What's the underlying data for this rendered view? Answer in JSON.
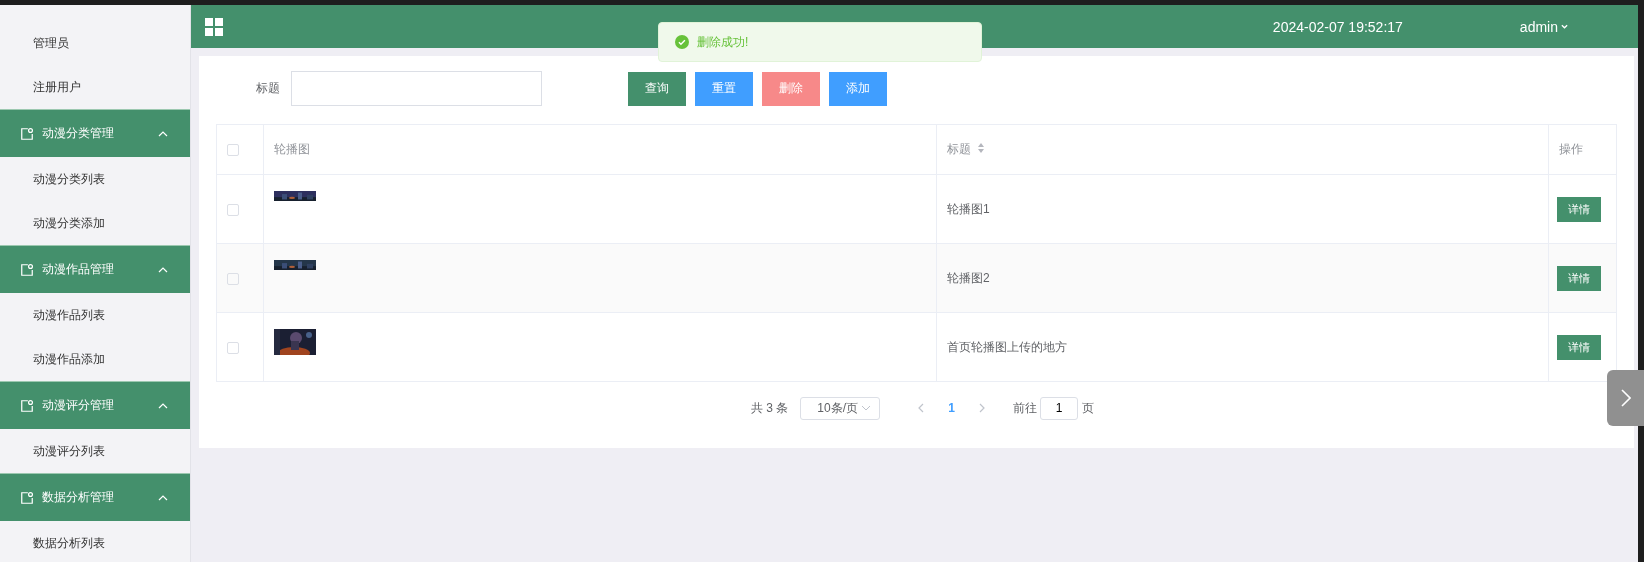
{
  "sidebar": {
    "items": [
      {
        "kind": "item",
        "label": "管理员"
      },
      {
        "kind": "item",
        "label": "注册用户"
      },
      {
        "kind": "group",
        "label": "动漫分类管理",
        "expanded": true,
        "children": [
          {
            "label": "动漫分类列表"
          },
          {
            "label": "动漫分类添加"
          }
        ]
      },
      {
        "kind": "group",
        "label": "动漫作品管理",
        "expanded": true,
        "children": [
          {
            "label": "动漫作品列表"
          },
          {
            "label": "动漫作品添加"
          }
        ]
      },
      {
        "kind": "group",
        "label": "动漫评分管理",
        "expanded": true,
        "children": [
          {
            "label": "动漫评分列表"
          }
        ]
      },
      {
        "kind": "group",
        "label": "数据分析管理",
        "expanded": true,
        "children": [
          {
            "label": "数据分析列表"
          }
        ]
      }
    ]
  },
  "header": {
    "datetime": "2024-02-07 19:52:17",
    "user": "admin"
  },
  "toast": {
    "kind": "success",
    "message": "删除成功!"
  },
  "search": {
    "label": "标题"
  },
  "buttons": [
    {
      "kind": "query",
      "label": "查询"
    },
    {
      "kind": "reset",
      "label": "重置"
    },
    {
      "kind": "delete",
      "label": "删除"
    },
    {
      "kind": "add",
      "label": "添加"
    }
  ],
  "table": {
    "columns": [
      {
        "kind": "check",
        "checked": false
      },
      {
        "label": "轮播图",
        "sortable": false
      },
      {
        "kind": "text",
        "label": "标题",
        "sortable": true
      },
      {
        "kind": "action",
        "label": "操作",
        "sortable": false
      }
    ],
    "rows": [
      {
        "checked": false,
        "title": "轮播图1",
        "action": "详情"
      },
      {
        "checked": false,
        "title": "轮播图2",
        "action": "详情"
      },
      {
        "checked": false,
        "title": "首页轮播图上传的地方",
        "action": "详情"
      }
    ]
  },
  "pagination": {
    "total": "共 3 条",
    "page_size": "10条/页",
    "pages": [
      {
        "label": "1",
        "selected": true
      }
    ],
    "goto_label": "前往",
    "goto_value": "1",
    "goto_suffix": "页"
  }
}
